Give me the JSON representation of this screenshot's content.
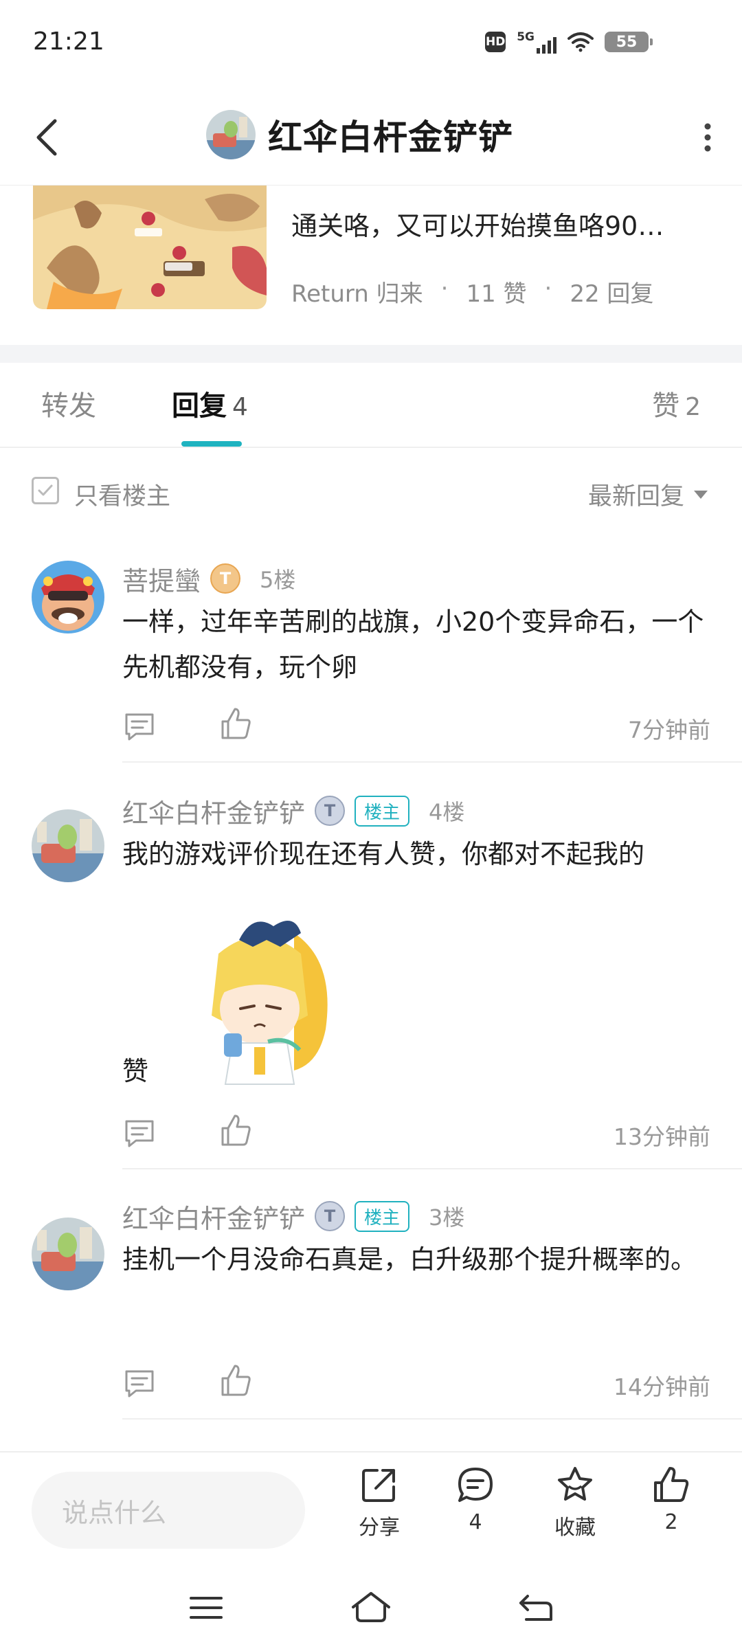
{
  "status_bar": {
    "time": "21:21",
    "hd_label": "HD",
    "network_label": "5G",
    "battery": "55"
  },
  "header": {
    "title": "红伞白杆金铲铲"
  },
  "post": {
    "text": "通关咯，又可以开始摸鱼咯90…",
    "author": "Return 归来",
    "likes": "11 赞",
    "replies": "22 回复"
  },
  "tabs": {
    "forward": "转发",
    "reply": "回复",
    "reply_count": "4",
    "like": "赞",
    "like_count": "2"
  },
  "filter": {
    "only_owner": "只看楼主",
    "sort": "最新回复"
  },
  "comments": [
    {
      "user": "菩提蠻",
      "badge": "T",
      "owner_tag": "",
      "floor": "5楼",
      "body": "一样，过年辛苦刷的战旗，小20个变异命石，一个先机都没有，玩个卵",
      "time": "7分钟前"
    },
    {
      "user": "红伞白杆金铲铲",
      "badge": "T",
      "owner_tag": "楼主",
      "floor": "4楼",
      "body": "我的游戏评价现在还有人赞，你都对不起我的",
      "body_tail": "赞",
      "time": "13分钟前"
    },
    {
      "user": "红伞白杆金铲铲",
      "badge": "T",
      "owner_tag": "楼主",
      "floor": "3楼",
      "body": "挂机一个月没命石真是，白升级那个提升概率的。",
      "time": "14分钟前"
    }
  ],
  "bottom_bar": {
    "input_placeholder": "说点什么",
    "share_label": "分享",
    "comment_count": "4",
    "favorite_label": "收藏",
    "like_count": "2"
  },
  "colors": {
    "accent": "#1fb3c0",
    "text_primary": "#1f1f1f",
    "text_secondary": "#8c8c8c"
  }
}
